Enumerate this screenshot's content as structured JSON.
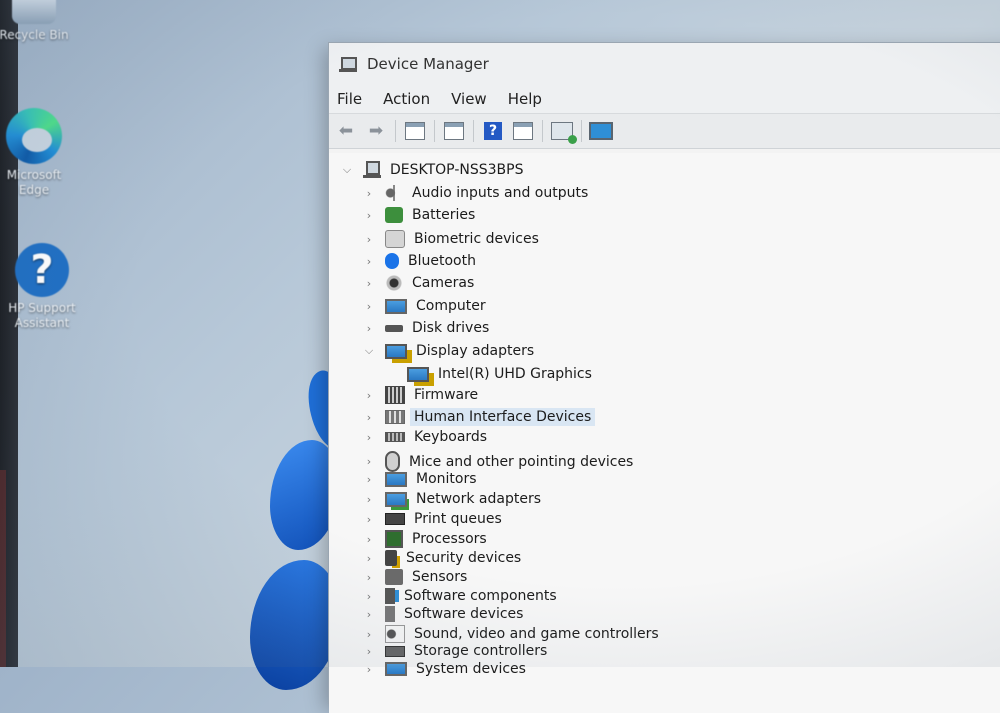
{
  "desktop": {
    "icons": [
      {
        "label": "Recycle Bin",
        "icon": "recycle-bin-icon"
      },
      {
        "label": "Microsoft Edge",
        "icon": "edge-icon"
      },
      {
        "label": "HP Support Assistant",
        "icon": "help-icon"
      }
    ]
  },
  "window": {
    "title": "Device Manager",
    "menu": [
      "File",
      "Action",
      "View",
      "Help"
    ],
    "toolbar": [
      "back-icon",
      "forward-icon",
      "properties-icon",
      "update-icon",
      "help-icon",
      "console-icon",
      "scan-hardware-icon",
      "monitor-icon"
    ]
  },
  "tree": {
    "root": "DESKTOP-NSS3BPS",
    "categories": [
      {
        "label": "Audio inputs and outputs",
        "icon": "speaker-icon",
        "expanded": false
      },
      {
        "label": "Batteries",
        "icon": "battery-icon",
        "expanded": false
      },
      {
        "label": "Biometric devices",
        "icon": "fingerprint-icon",
        "expanded": false
      },
      {
        "label": "Bluetooth",
        "icon": "bluetooth-icon",
        "expanded": false
      },
      {
        "label": "Cameras",
        "icon": "camera-icon",
        "expanded": false
      },
      {
        "label": "Computer",
        "icon": "computer-icon",
        "expanded": false
      },
      {
        "label": "Disk drives",
        "icon": "disk-drive-icon",
        "expanded": false
      },
      {
        "label": "Display adapters",
        "icon": "display-adapter-icon",
        "expanded": true,
        "children": [
          {
            "label": "Intel(R) UHD Graphics",
            "icon": "display-adapter-icon"
          }
        ]
      },
      {
        "label": "Firmware",
        "icon": "firmware-icon",
        "expanded": false
      },
      {
        "label": "Human Interface Devices",
        "icon": "hid-icon",
        "expanded": false,
        "selected": true
      },
      {
        "label": "Keyboards",
        "icon": "keyboard-icon",
        "expanded": false
      },
      {
        "label": "Mice and other pointing devices",
        "icon": "mouse-icon",
        "expanded": false
      },
      {
        "label": "Monitors",
        "icon": "monitor-icon",
        "expanded": false
      },
      {
        "label": "Network adapters",
        "icon": "network-adapter-icon",
        "expanded": false
      },
      {
        "label": "Print queues",
        "icon": "printer-icon",
        "expanded": false
      },
      {
        "label": "Processors",
        "icon": "processor-icon",
        "expanded": false
      },
      {
        "label": "Security devices",
        "icon": "security-device-icon",
        "expanded": false
      },
      {
        "label": "Sensors",
        "icon": "sensor-icon",
        "expanded": false
      },
      {
        "label": "Software components",
        "icon": "software-component-icon",
        "expanded": false
      },
      {
        "label": "Software devices",
        "icon": "software-device-icon",
        "expanded": false
      },
      {
        "label": "Sound, video and game controllers",
        "icon": "sound-icon",
        "expanded": false
      },
      {
        "label": "Storage controllers",
        "icon": "storage-controller-icon",
        "expanded": false
      },
      {
        "label": "System devices",
        "icon": "system-device-icon",
        "expanded": false
      }
    ]
  },
  "colors": {
    "selection": "#d9e6f3",
    "accent": "#1a73e8"
  }
}
